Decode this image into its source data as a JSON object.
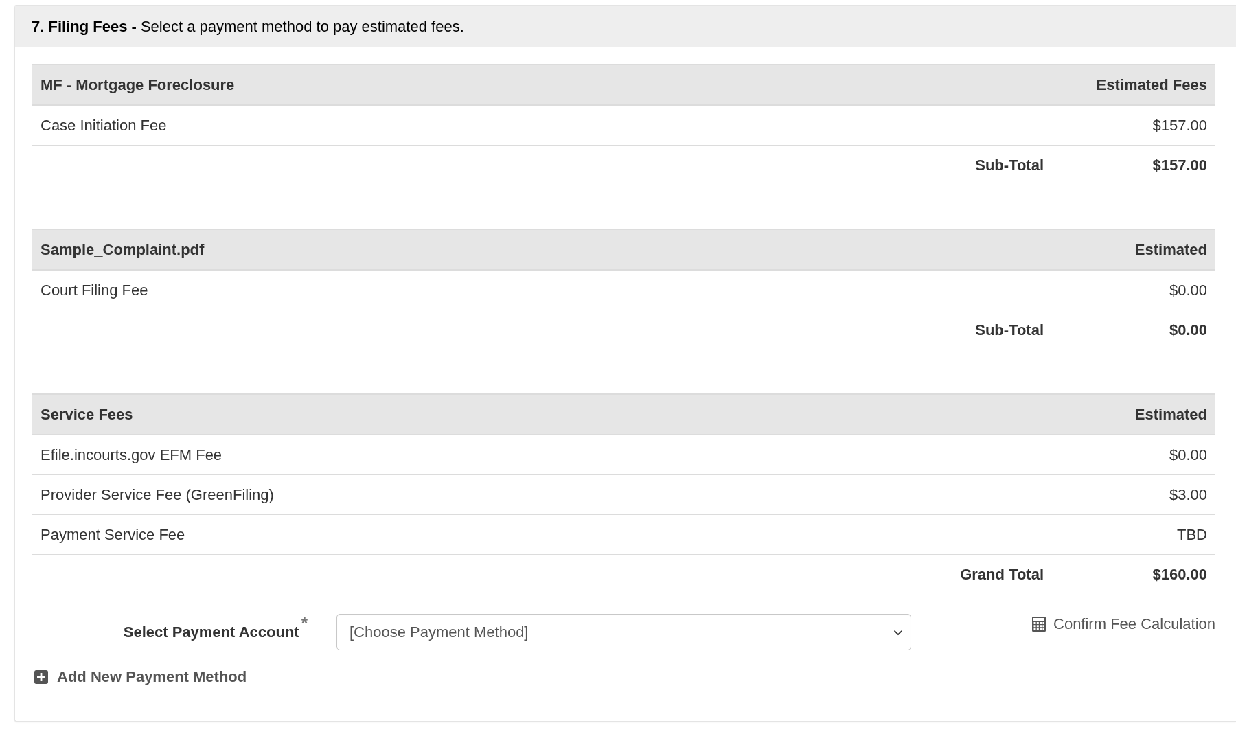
{
  "section": {
    "title": "**7. Filing Fees -** Select a payment method to pay estimated fees."
  },
  "fee_tables": [
    {
      "title": "MF - Mortgage Foreclosure",
      "amount_heading": "Estimated Fees",
      "rows": [
        {
          "label": "Case Initiation Fee",
          "amount": "$157.00"
        }
      ],
      "total": {
        "label": "Sub-Total",
        "amount": "$157.00"
      }
    },
    {
      "title": "Sample_Complaint.pdf",
      "amount_heading": "Estimated",
      "rows": [
        {
          "label": "Court Filing Fee",
          "amount": "$0.00"
        }
      ],
      "total": {
        "label": "Sub-Total",
        "amount": "$0.00"
      }
    },
    {
      "title": "Service Fees",
      "amount_heading": "Estimated",
      "rows": [
        {
          "label": "Efile.incourts.gov EFM Fee",
          "amount": "$0.00"
        },
        {
          "label": "Provider Service Fee (GreenFiling)",
          "amount": "$3.00"
        },
        {
          "label": "Payment Service Fee",
          "amount": "TBD"
        }
      ],
      "total": {
        "label": "Grand Total",
        "amount": "$160.00"
      }
    }
  ],
  "payment": {
    "label": "Select Payment Account",
    "required_mark": "*",
    "select": {
      "placeholder": "[Choose Payment Method]"
    },
    "confirm_link": "Confirm Fee Calculation",
    "add_link": "Add New Payment Method"
  }
}
